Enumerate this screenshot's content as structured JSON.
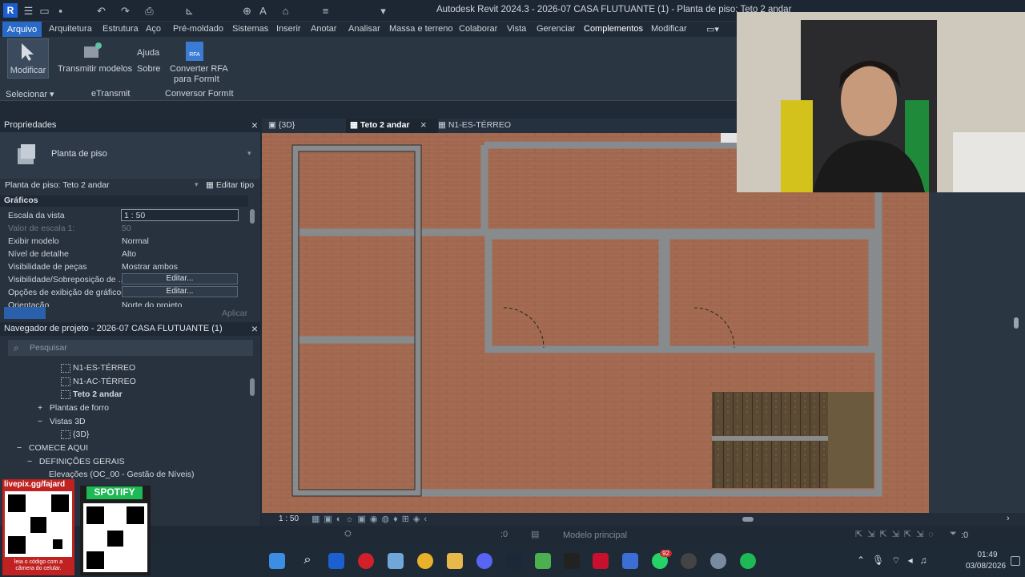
{
  "title_bar": {
    "text": "Autodesk Revit 2024.3 - 2026-07 CASA FLUTUANTE (1) - Planta de piso: Teto 2 andar"
  },
  "menu": {
    "file": "Arquivo",
    "tabs": [
      "Arquitetura",
      "Estrutura",
      "Aço",
      "Pré-moldado",
      "Sistemas",
      "Inserir",
      "Anotar",
      "Analisar",
      "Massa e terreno",
      "Colaborar",
      "Vista",
      "Gerenciar",
      "Complementos",
      "Modificar"
    ]
  },
  "ribbon": {
    "modify": "Modificar",
    "transmit": "Transmitir modelos",
    "help": "Ajuda",
    "about": "Sobre",
    "convert_line1": "Converter RFA",
    "convert_line2": "para FormIt",
    "select": "Selecionar",
    "etransmit": "eTransmit",
    "formit": "Conversor FormIt",
    "rfa_badge": "RFA"
  },
  "properties": {
    "title": "Propriedades",
    "type_name": "Planta de piso",
    "instance": "Planta de piso: Teto 2 andar",
    "edit_type": "Editar tipo",
    "section": "Gráficos",
    "rows": [
      {
        "k": "Escala da vista",
        "v": "1 : 50"
      },
      {
        "k": "Valor de escala    1:",
        "v": "50"
      },
      {
        "k": "Exibir modelo",
        "v": "Normal"
      },
      {
        "k": "Nível de detalhe",
        "v": "Alto"
      },
      {
        "k": "Visibilidade de peças",
        "v": "Mostrar ambos"
      },
      {
        "k": "Visibilidade/Sobreposição de ...",
        "v": "Editar..."
      },
      {
        "k": "Opções de exibição de gráficos",
        "v": "Editar..."
      },
      {
        "k": "Orientação",
        "v": "Norte do projeto"
      }
    ],
    "apply": "Aplicar"
  },
  "browser": {
    "title": "Navegador de projeto - 2026-07 CASA FLUTUANTE (1)",
    "search_placeholder": "Pesquisar",
    "items": [
      "N1-ES-TÉRREO",
      "N1-AC-TÉRREO",
      "Teto 2 andar",
      "Plantas de forro",
      "Vistas 3D",
      "{3D}",
      "COMECE AQUI",
      "DEFINIÇÕES GERAIS",
      "Elevações (OC_00 - Gestão de Níveis)"
    ]
  },
  "view_tabs": [
    "{3D}",
    "Teto 2 andar",
    "N1-ES-TÉRREO"
  ],
  "view_scale": "1 : 50",
  "status": {
    "model": "Modelo principal",
    "count_a": ":0",
    "count_b": ":0"
  },
  "overlay": {
    "livepix": "livepix.gg/fajard",
    "spotify": "SPOTIFY",
    "caption": "leia o código com a câmera do celular."
  },
  "taskbar": {
    "time": "01:49",
    "date": "03/08/2026",
    "badge1": "92"
  }
}
